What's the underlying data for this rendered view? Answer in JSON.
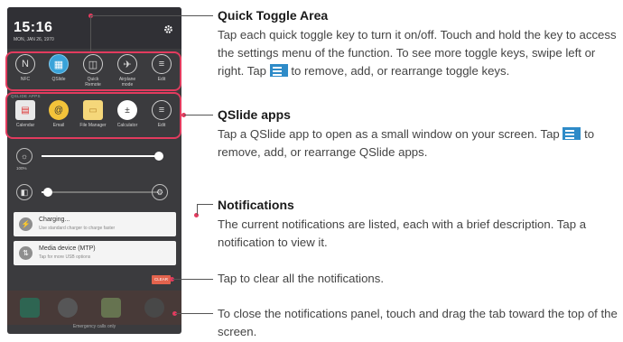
{
  "phone": {
    "time": "15:16",
    "date": "MON, JAN 26, 1970",
    "toggles": [
      {
        "label": "NFC",
        "icon": "N"
      },
      {
        "label": "QSlide",
        "icon": "▦",
        "on": true
      },
      {
        "label": "Quick Remote",
        "icon": "◫"
      },
      {
        "label": "Airplane mode",
        "icon": "✈"
      },
      {
        "label": "Edit",
        "icon": "≡"
      }
    ],
    "qslide_header": "QSLIDE APPS",
    "qslide_apps": [
      {
        "label": "Calendar",
        "icon": "▤",
        "bg": "#e9e9e9",
        "color": "#d33"
      },
      {
        "label": "Email",
        "icon": "@",
        "bg": "#f3c33a",
        "color": "#333"
      },
      {
        "label": "File Manager",
        "icon": "▭",
        "bg": "#f5d77a",
        "color": "#b8862a"
      },
      {
        "label": "Calculator",
        "icon": "±",
        "bg": "#ffffff",
        "color": "#333"
      },
      {
        "label": "Edit",
        "icon": "≡",
        "bg": "transparent",
        "color": "#ddd"
      }
    ],
    "brightness_label": "100%",
    "brightness_level": 1.0,
    "volume_level": 0.05,
    "notifications": [
      {
        "title": "Charging...",
        "subtitle": "Use standard charger to charge faster",
        "icon": "⚡"
      },
      {
        "title": "Media device (MTP)",
        "subtitle": "Tap for more USB options",
        "icon": "⇅"
      }
    ],
    "clear_label": "CLEAR",
    "emergency_text": "Emergency calls only"
  },
  "callouts": {
    "quick_toggle": {
      "title": "Quick Toggle Area",
      "body_1": "Tap each quick toggle key to turn it on/off. Touch and hold the key to access the settings menu of the function. To see more toggle keys, swipe left or right. Tap",
      "body_2": "to remove, add, or rearrange toggle keys."
    },
    "qslide": {
      "title": "QSlide apps",
      "body_1": "Tap a QSlide app to open as a small window on your screen. Tap",
      "body_2": "to remove, add, or rearrange QSlide apps."
    },
    "notifications": {
      "title": "Notifications",
      "body": "The current notifications are listed, each with a brief description. Tap a notification to view it."
    },
    "clear": {
      "body": "Tap to clear all the notifications."
    },
    "close": {
      "body": "To close the notifications panel, touch and drag the tab toward the top of the screen."
    }
  },
  "colors": {
    "accent": "#e23b5e",
    "edit_icon": "#2e8bc8"
  }
}
